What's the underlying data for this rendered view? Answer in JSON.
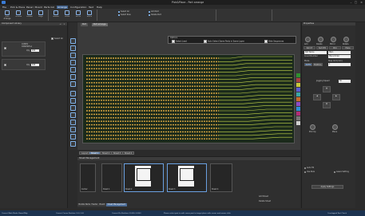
{
  "window": {
    "title": "Pick&Place - Part arrange"
  },
  "menu": [
    "File",
    "Pick & Place",
    "Panel / Board",
    "Parts list",
    "Arrange",
    "Configuration",
    "Test",
    "Help"
  ],
  "menu_active_index": 4,
  "ribbon": {
    "buttons": [
      "Auto Arrange",
      "Fiducial",
      "Rotate",
      "Align",
      "Nozzle",
      "Move",
      "Mirror",
      "Zoom"
    ],
    "small_items": [
      "Select All",
      "Select Row",
      "Add Part",
      "Delete Part"
    ]
  },
  "left_panel": {
    "title": "Component Library",
    "select_all_label": "Select All",
    "item1": {
      "name": "COMP1",
      "part_code": "C0603RH-A",
      "qty_label": "Qty",
      "qty": "200"
    },
    "item2": {
      "qty_label": "Qty",
      "qty": "100"
    }
  },
  "canvas": {
    "tabs": [
      "Part",
      "Part arrange"
    ],
    "options": {
      "title": "Options",
      "items": [
        "Select Lead",
        "Auto Select Same Parts in Same Layer",
        "Hide Sequences"
      ]
    },
    "sheet_tabs": [
      "Layout",
      "Sheet 1",
      "Sheet 2",
      "Sheet 3",
      "Sheet 4"
    ],
    "sheet_active_index": 1
  },
  "bottom_panel": {
    "title": "Sheet Management",
    "thumbs": [
      "Carrier",
      "Sheet 1",
      "Sheet 2",
      "Sheet 3",
      "Sheet 4"
    ],
    "count_label": "Count",
    "add_sheet": "Add Sheet",
    "delete_sheet": "Delete Sheet",
    "tabs": [
      "Nozzle Name",
      "Feeder",
      "Board",
      "Sheet Management"
    ],
    "tab_active_index": 3
  },
  "right_panel": {
    "title": "Properties",
    "top_buttons": [
      "Add",
      "Delete",
      "Mirror",
      "Rotate"
    ],
    "tabs": [
      "Set XY",
      "Set XYR",
      "Pick",
      "Place"
    ],
    "row1_select": "Part Name",
    "row1_select2": "Main",
    "count_label": "Count Number",
    "count_value": "Place Order",
    "mode_label": "Mode",
    "auto_label": "AUTO",
    "manual_label": "MANUAL",
    "step_label": "Step Unit (mm)",
    "step_value": "1",
    "jog_label": "Jogging Speed",
    "jog_value": "50",
    "pick_label": "Pick Up",
    "place_label": "Place",
    "check1": "Auto Fill",
    "check2": "Use Rule",
    "check3": "Leave Setting",
    "apply_label": "Apply Settings"
  },
  "colors": {
    "accent": "#3d5f8c",
    "status_bg": "#1c3350",
    "pcb_trace": "#d9a640",
    "pcb_bg": "#1b2a1b",
    "swatches": [
      "#2f8f2f",
      "#a64040",
      "#c7c73a",
      "#5a5ad0",
      "#3aa6a6",
      "#c76a2b",
      "#8d4bc7",
      "#2b8fd6",
      "#b32d77",
      "#777777",
      "#d0d0d0"
    ]
  },
  "status": [
    "Current Work Mode: Board Mdy",
    "Current Cursor Position: (0.0, 0.0)",
    "Current Pin Position: (0.000, 0.000)",
    "Please select part to edit, move part to target place with cursor and mouse click",
    "Overlapped Part Check"
  ]
}
